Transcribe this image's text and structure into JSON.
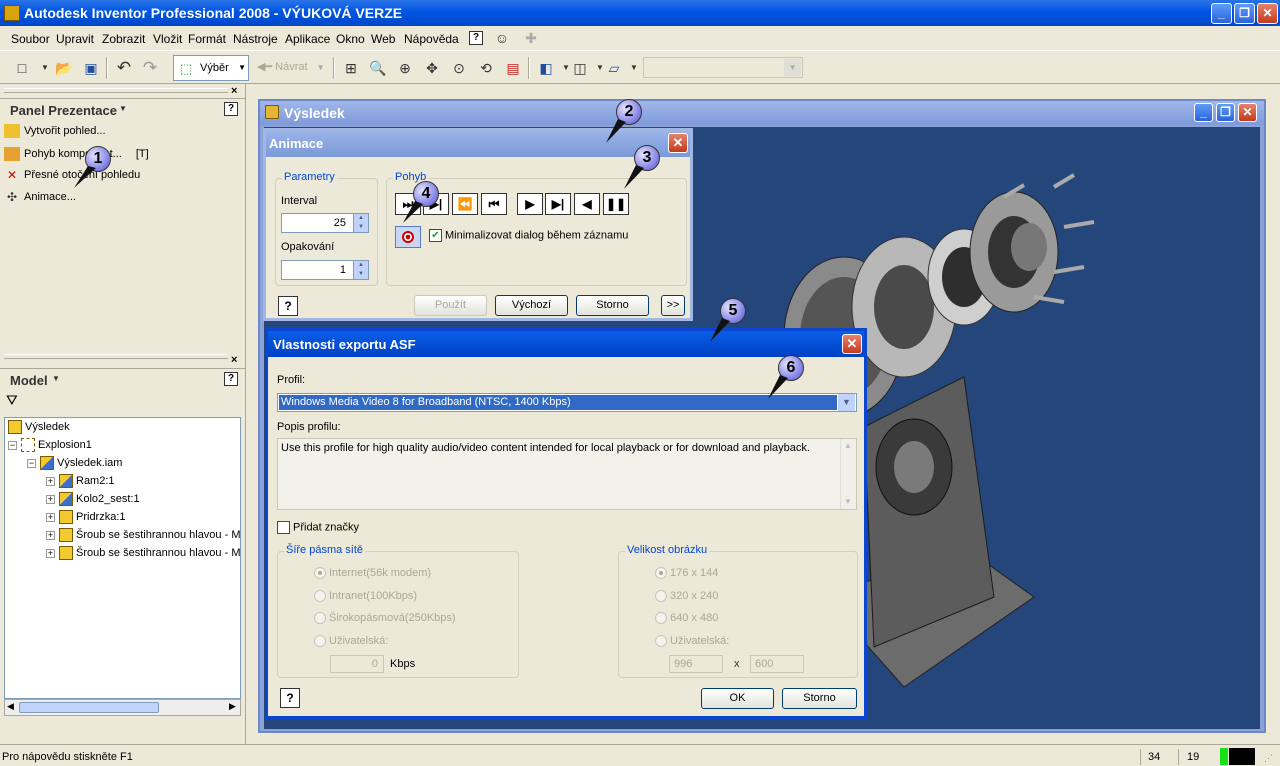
{
  "window": {
    "title": "Autodesk Inventor Professional 2008 - VÝUKOVÁ VERZE",
    "btn_min": "_",
    "btn_max": "❐",
    "btn_close": "✕"
  },
  "menu": [
    "Soubor",
    "Upravit",
    "Zobrazit",
    "Vložit",
    "Formát",
    "Nástroje",
    "Aplikace",
    "Okno",
    "Web",
    "Nápověda"
  ],
  "toolbar": {
    "select_label": "Výběr",
    "back_label": "Návrat"
  },
  "panel": {
    "title": "Panel Prezentace",
    "items": [
      "Vytvořit pohled...",
      "Pohyb komponent...",
      "[T]",
      "Přesné otočení pohledu",
      "Animace..."
    ]
  },
  "model": {
    "title": "Model",
    "tree": [
      "Výsledek",
      "Explosion1",
      "Výsledek.iam",
      "Ram2:1",
      "Kolo2_sest:1",
      "Pridrzka:1",
      "Šroub se šestihrannou hlavou - M",
      "Šroub se šestihrannou hlavou - M"
    ]
  },
  "status": {
    "help": "Pro nápovědu stiskněte F1",
    "x": "34",
    "y": "19"
  },
  "doc": {
    "title": "Výsledek"
  },
  "anim": {
    "title": "Animace",
    "params_label": "Parametry",
    "interval_label": "Interval",
    "interval_value": "25",
    "repeat_label": "Opakování",
    "repeat_value": "1",
    "motion_label": "Pohyb",
    "minimize_label": "Minimalizovat dialog během záznamu",
    "apply": "Použít",
    "default": "Výchozí",
    "cancel": "Storno",
    "more": ">>"
  },
  "asf": {
    "title": "Vlastnosti exportu ASF",
    "profile_label": "Profil:",
    "profile_value": "Windows Media Video 8 for Broadband (NTSC, 1400 Kbps)",
    "desc_label": "Popis profilu:",
    "desc_text": "Use this profile for high quality audio/video content intended for local playback or for download and playback.",
    "marks_label": "Přidat značky",
    "bw_label": "Šíře pásma sítě",
    "bw_options": [
      "Internet(56k modem)",
      "Intranet(100Kbps)",
      "Širokopásmová(250Kbps)",
      "Uživatelská:"
    ],
    "bw_value": "0",
    "bw_unit": "Kbps",
    "size_label": "Velikost obrázku",
    "size_options": [
      "176 x 144",
      "320 x 240",
      "640 x 480",
      "Uživatelská:"
    ],
    "width_value": "996",
    "x_sep": "x",
    "height_value": "600",
    "ok": "OK",
    "cancel": "Storno"
  },
  "callouts": [
    "1",
    "2",
    "3",
    "4",
    "5",
    "6"
  ],
  "help_glyph": "?"
}
